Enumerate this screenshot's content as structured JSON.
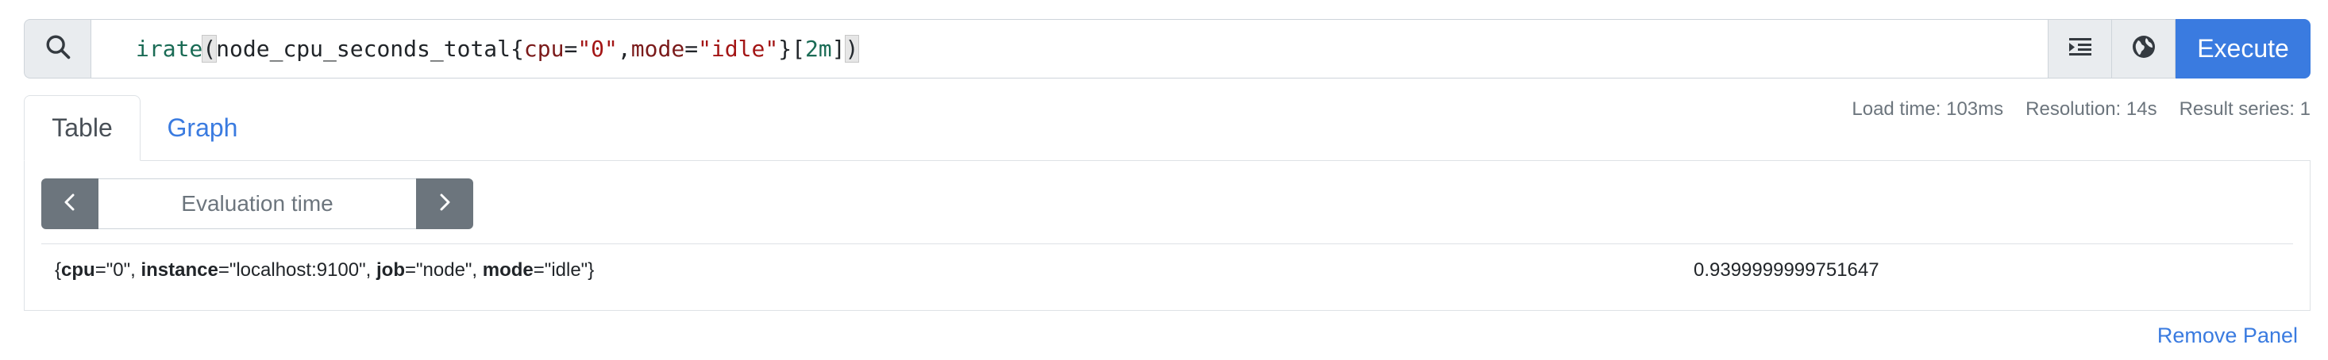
{
  "query": {
    "func": "irate",
    "open_paren": "(",
    "metric": "node_cpu_seconds_total",
    "open_brace": "{",
    "label1_name": "cpu",
    "eq1": "=",
    "label1_value": "\"0\"",
    "comma": ",",
    "label2_name": "mode",
    "eq2": "=",
    "label2_value": "\"idle\"",
    "close_brace": "}",
    "open_bracket": "[",
    "duration": "2m",
    "close_bracket": "]",
    "close_paren": ")"
  },
  "icons": {
    "search": "search-icon",
    "format": "format-indent-icon",
    "metrics": "globe-icon",
    "prev": "chevron-left-icon",
    "next": "chevron-right-icon"
  },
  "execute_label": "Execute",
  "tabs": [
    {
      "label": "Table",
      "active": true
    },
    {
      "label": "Graph",
      "active": false
    }
  ],
  "stats": {
    "load_time": "Load time: 103ms",
    "resolution": "Resolution: 14s",
    "result_series": "Result series: 1"
  },
  "evaluation": {
    "placeholder": "Evaluation time"
  },
  "result": {
    "brace_open": "{",
    "l1_name": "cpu",
    "l1_rest": "=\"0\", ",
    "l2_name": "instance",
    "l2_rest": "=\"localhost:9100\", ",
    "l3_name": "job",
    "l3_rest": "=\"node\", ",
    "l4_name": "mode",
    "l4_rest": "=\"idle\"",
    "brace_close": "}",
    "value": "0.9399999999751647"
  },
  "remove_panel": "Remove Panel",
  "colors": {
    "accent": "#3a7be0",
    "secondary_button": "#6c757d",
    "addon_background": "#e9ecef"
  }
}
